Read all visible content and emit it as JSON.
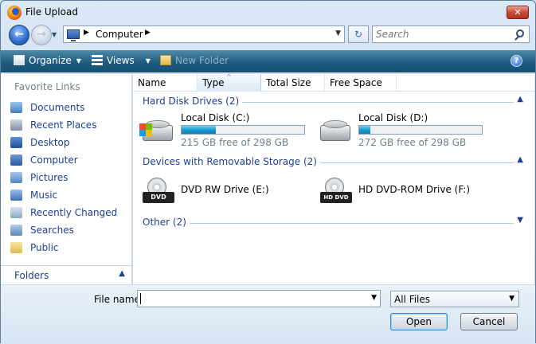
{
  "window": {
    "title": "File Upload",
    "close": "✕"
  },
  "nav": {
    "back": "←",
    "forward": "→",
    "history_caret": "▼",
    "address_text": "Computer",
    "address_sep": "▶",
    "address_drop": "▼",
    "refresh": "↻",
    "search_placeholder": "Search"
  },
  "toolbar": {
    "organize": "Organize",
    "views": "Views",
    "new_folder": "New Folder",
    "caret": "▼",
    "help": "?"
  },
  "sidebar": {
    "title": "Favorite Links",
    "items": [
      {
        "label": "Documents"
      },
      {
        "label": "Recent Places"
      },
      {
        "label": "Desktop"
      },
      {
        "label": "Computer"
      },
      {
        "label": "Pictures"
      },
      {
        "label": "Music"
      },
      {
        "label": "Recently Changed"
      },
      {
        "label": "Searches"
      },
      {
        "label": "Public"
      }
    ],
    "folders": "Folders",
    "folders_chevron": "▲"
  },
  "columns": [
    "Name",
    "Type",
    "Total Size",
    "Free Space"
  ],
  "sort_caret": "^",
  "groups": {
    "hdd": "Hard Disk Drives (2)",
    "removable": "Devices with Removable Storage (2)",
    "other": "Other (2)",
    "collapse": "▲",
    "expand": "▼"
  },
  "drives": {
    "c": {
      "name": "Local Disk (C:)",
      "free": "215 GB free of 298 GB",
      "used_fraction": 0.28
    },
    "d": {
      "name": "Local Disk (D:)",
      "free": "272 GB free of 298 GB",
      "used_fraction": 0.09
    }
  },
  "removable": {
    "e": {
      "name": "DVD RW Drive (E:)",
      "badge": "DVD"
    },
    "f": {
      "name": "HD DVD-ROM Drive (F:)",
      "badge": "HD DVD"
    }
  },
  "footer": {
    "filename_label": "File name:",
    "filename_value": "",
    "filename_drop": "▼",
    "filter": "All Files",
    "filter_drop": "▼",
    "open": "Open",
    "cancel": "Cancel"
  }
}
